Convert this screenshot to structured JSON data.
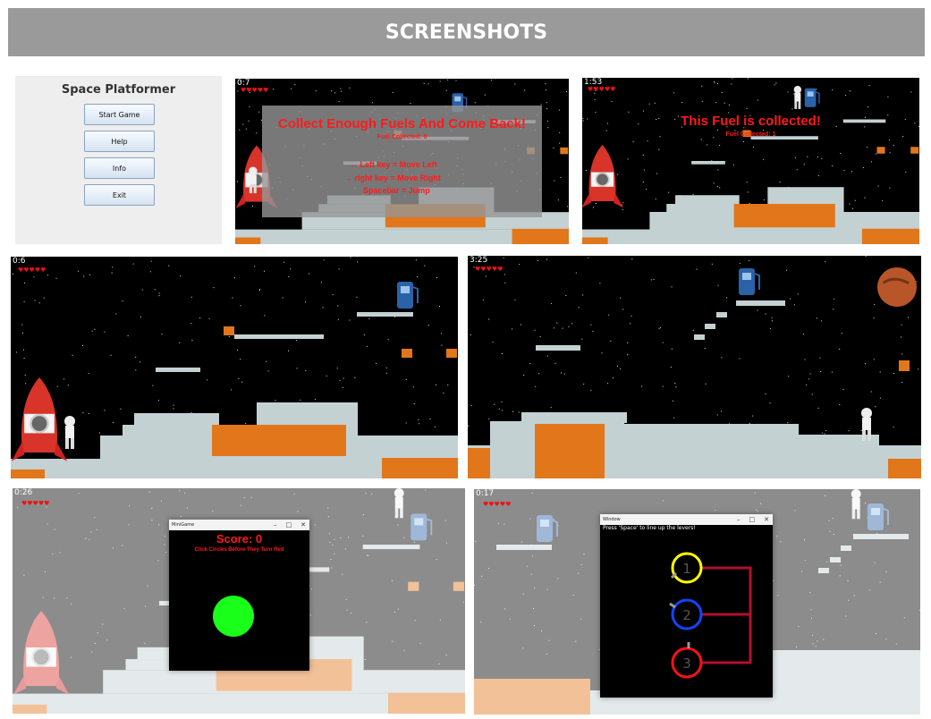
{
  "banner": {
    "title": "SCREENSHOTS"
  },
  "menu": {
    "title": "Space Platformer",
    "buttons": [
      "Start Game",
      "Help",
      "Info",
      "Exit"
    ]
  },
  "shot1": {
    "timer": "0:7",
    "hearts": "♥♥♥♥♥",
    "headline": "Collect Enough Fuels And Come Back!",
    "fuel": "Fuel Collected: 0",
    "controls": [
      "←  Left key  =  Move Left",
      "→  right key  =  Move Right",
      "Spacebar  =  Jump"
    ]
  },
  "shot2": {
    "timer": "1:53",
    "hearts": "♥♥♥♥♥",
    "headline": "This Fuel is collected!",
    "fuel": "Fuel Collected: 1"
  },
  "shot3": {
    "timer": "0:6",
    "hearts": "♥♥♥♥♥"
  },
  "shot4": {
    "timer": "3:25",
    "hearts": "♥♥♥♥♥"
  },
  "shot5": {
    "timer": "0:26",
    "hearts": "♥♥♥♥♥",
    "window_title": "MiniGame",
    "score": "Score: 0",
    "instruction": "Click Circles Before They Turn Red"
  },
  "shot6": {
    "timer": "0:17",
    "hearts": "♥♥♥♥♥",
    "window_title": "Window",
    "instruction": "Press 'Space' to line up the levers!",
    "levers": [
      "1",
      "2",
      "3"
    ]
  },
  "window_controls": [
    "–",
    "□",
    "✕"
  ],
  "colors": {
    "banner": "#9a9a9a",
    "rock": "#c3d1d3",
    "lava": "#e2761b",
    "red_text": "#ff1a1a",
    "green_circle": "#19ff19"
  }
}
